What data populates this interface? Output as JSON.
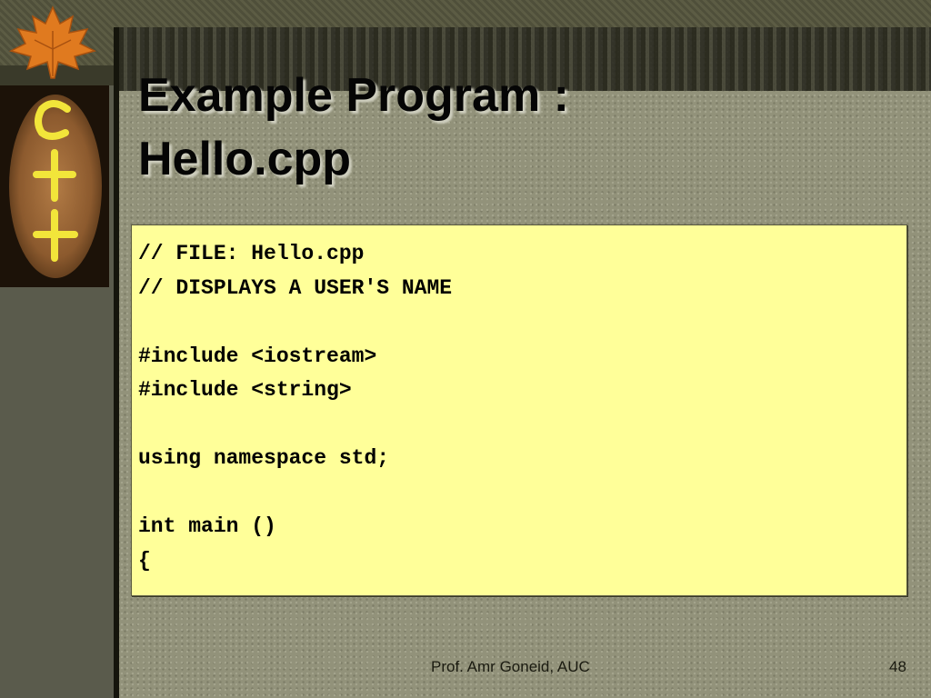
{
  "slide": {
    "title_line1": "Example Program :",
    "title_line2": "Hello.cpp",
    "logo_text": "C\n+\n+",
    "code_lines": [
      "// FILE: Hello.cpp",
      "// DISPLAYS A USER'S NAME",
      "",
      "#include <iostream>",
      "#include <string>",
      "",
      "using namespace std;",
      "",
      "int main ()",
      "{"
    ],
    "footer": "Prof. Amr Goneid, AUC",
    "page_number": "48"
  },
  "colors": {
    "code_background": "#ffff99",
    "logo_glyph": "#f2e53a",
    "leaf": "#e07a1f"
  },
  "icons": {
    "decoration": "maple-leaf-icon",
    "logo": "cpp-logo-icon"
  }
}
